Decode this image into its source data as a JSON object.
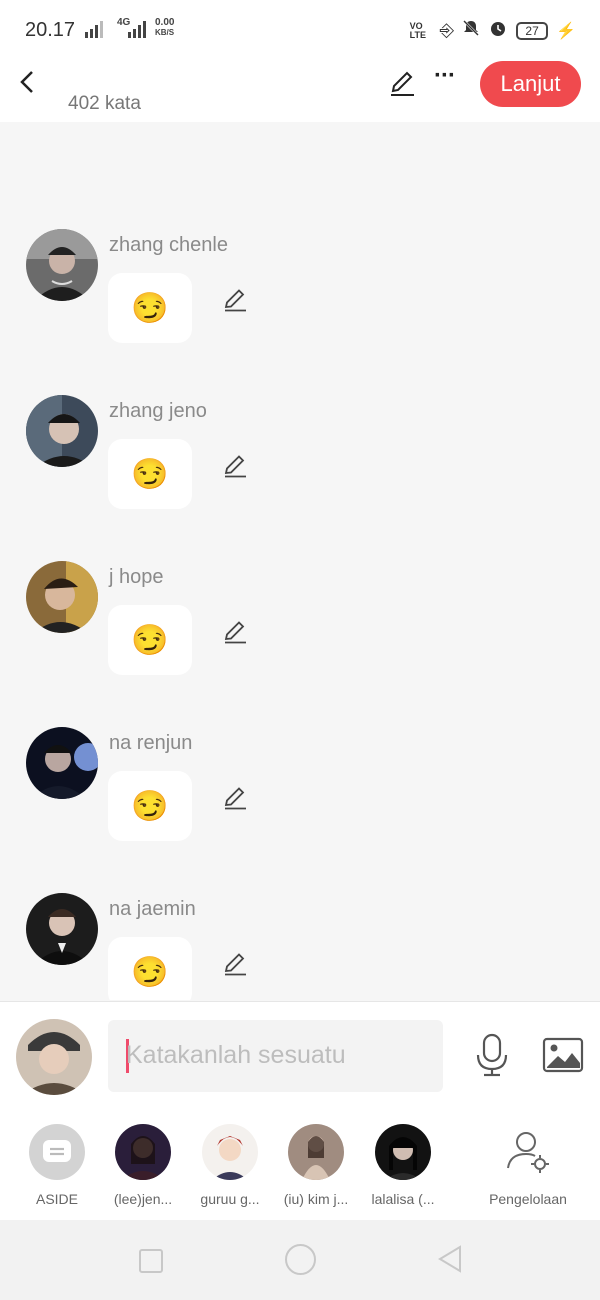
{
  "status_bar": {
    "time": "20.17",
    "network_type": "4G",
    "data_speed": "0.00",
    "data_unit": "KB/S",
    "volte": "VO LTE",
    "battery": "27",
    "icons": [
      "signal-icon",
      "signal-icon",
      "volte-icon",
      "gamepad-icon",
      "bell-off-icon",
      "alarm-icon",
      "battery-icon",
      "charging-icon"
    ]
  },
  "header": {
    "word_count": "402 kata",
    "next_label": "Lanjut",
    "back_icon": "back-arrow-icon",
    "edit_icon": "pencil-icon",
    "more_icon": "more-dots-icon"
  },
  "colors": {
    "accent": "#f04a4e",
    "caret": "#ef4b6b"
  },
  "messages": [
    {
      "name": "",
      "text": "😏"
    },
    {
      "name": "zhang chenle",
      "text": "😏"
    },
    {
      "name": "zhang jeno",
      "text": "😏"
    },
    {
      "name": "j hope",
      "text": "😏"
    },
    {
      "name": "na renjun",
      "text": "😏"
    },
    {
      "name": "na jaemin",
      "text": "😏"
    }
  ],
  "composer": {
    "placeholder": "Katakanlah sesuatu",
    "mic_icon": "microphone-icon",
    "image_icon": "image-icon"
  },
  "characters": [
    {
      "label": "ASIDE"
    },
    {
      "label": "(lee)jen..."
    },
    {
      "label": "guruu g..."
    },
    {
      "label": "(iu) kim j..."
    },
    {
      "label": "lalalisa (..."
    },
    {
      "label": "Pengelolaan"
    }
  ],
  "nav": [
    "recent-apps-icon",
    "home-icon",
    "back-icon"
  ]
}
